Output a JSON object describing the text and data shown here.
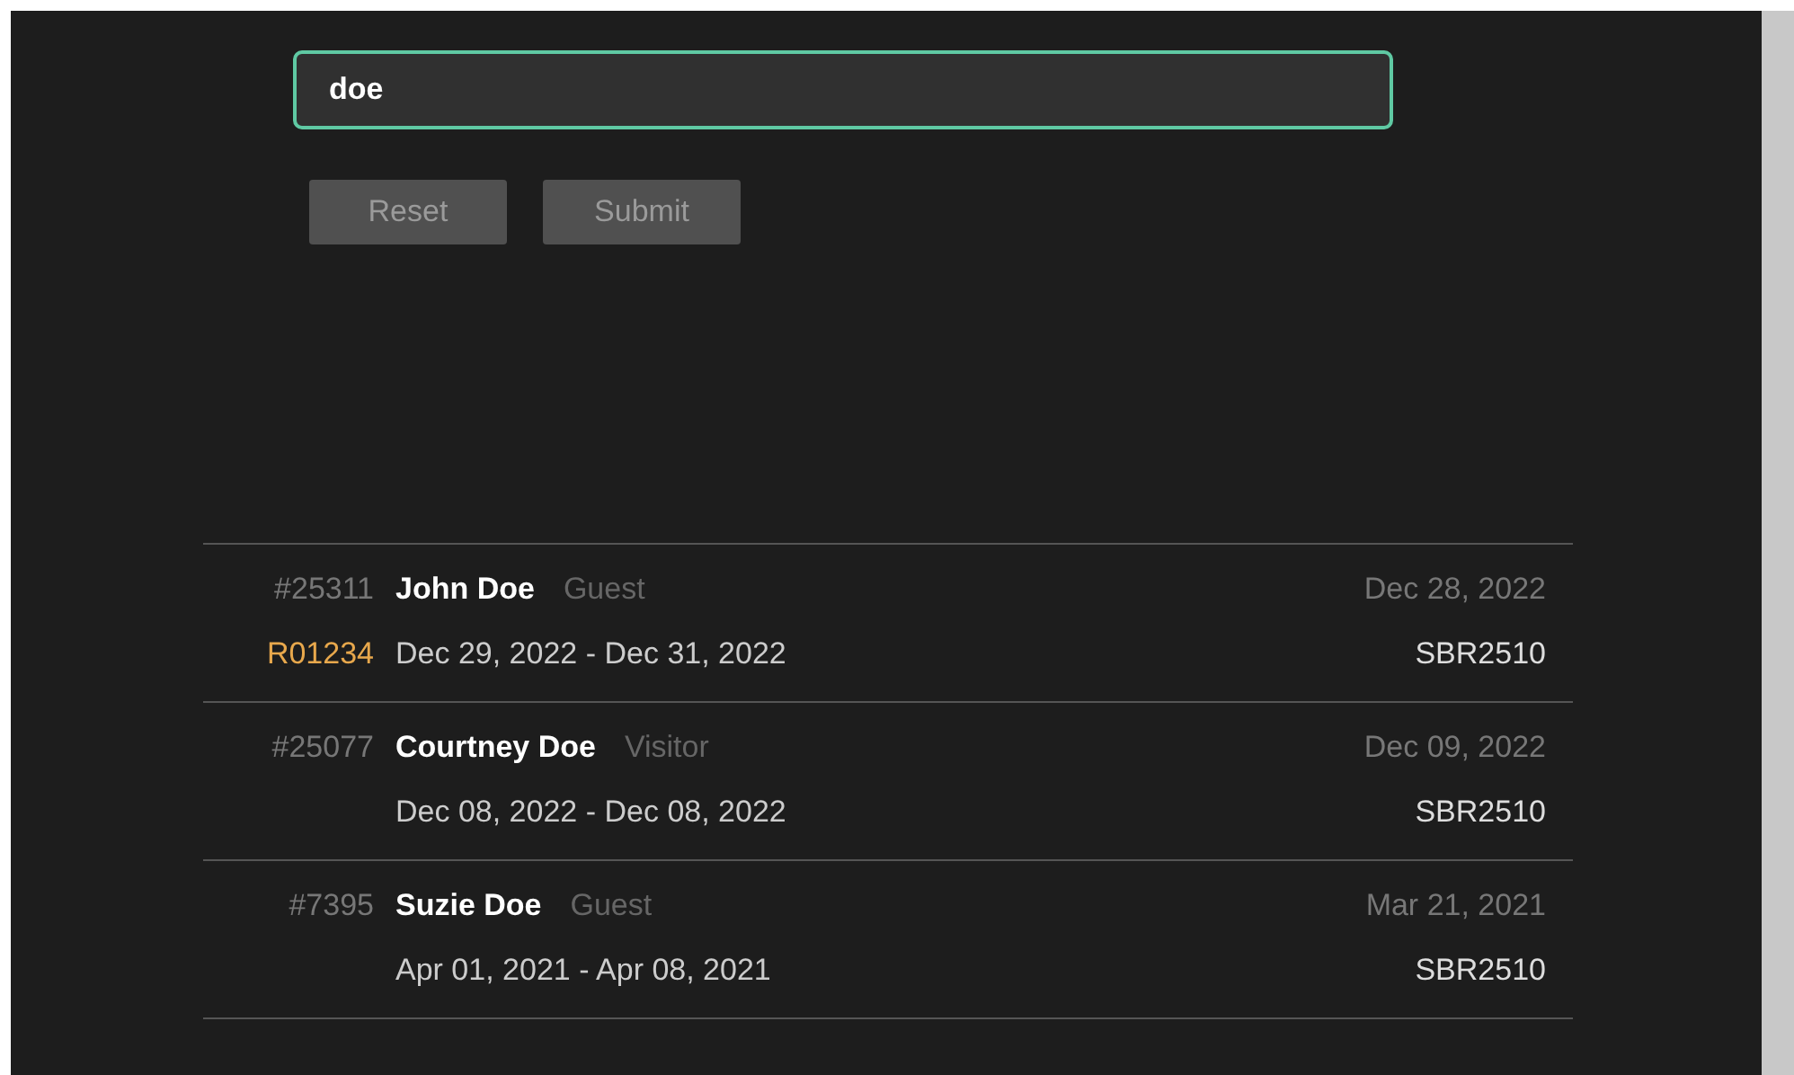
{
  "search": {
    "value": "doe"
  },
  "buttons": [
    {
      "label": "Reset",
      "disabled": true
    },
    {
      "label": "Submit",
      "disabled": true
    }
  ],
  "results": [
    {
      "number": "#25311",
      "name": "John Doe",
      "role": "Guest",
      "created": "Dec 28, 2022",
      "ref": "R01234",
      "dates": "Dec 29, 2022 - Dec 31, 2022",
      "code": "SBR2510"
    },
    {
      "number": "#25077",
      "name": "Courtney Doe",
      "role": "Visitor",
      "created": "Dec 09, 2022",
      "dates": "Dec 08, 2022 - Dec 08, 2022",
      "code": "SBR2510"
    },
    {
      "number": "#7395",
      "name": "Suzie Doe",
      "role": "Guest",
      "created": "Mar 21, 2021",
      "dates": "Apr 01, 2021 - Apr 08, 2021",
      "code": "SBR2510"
    }
  ]
}
